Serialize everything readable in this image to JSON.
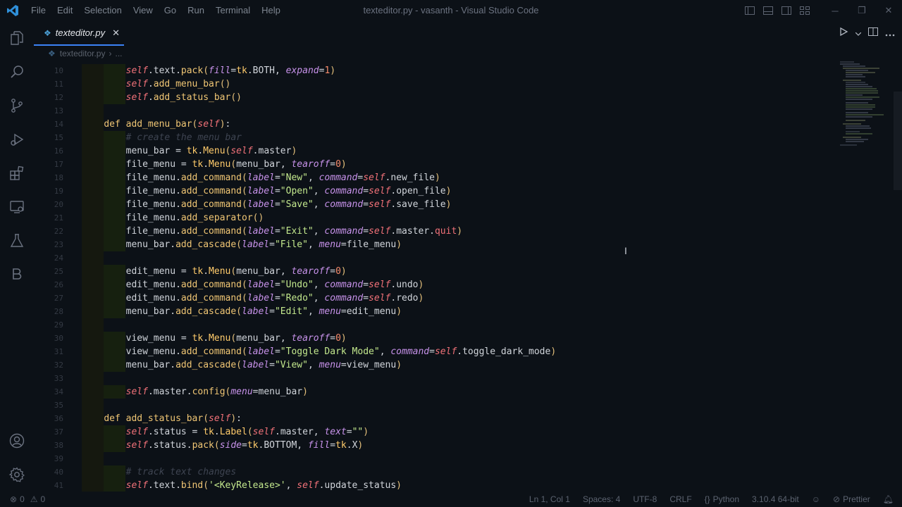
{
  "window": {
    "title": "texteditor.py - vasanth - Visual Studio Code"
  },
  "menu": [
    "File",
    "Edit",
    "Selection",
    "View",
    "Go",
    "Run",
    "Terminal",
    "Help"
  ],
  "tab": {
    "label": "texteditor.py",
    "close": "✕"
  },
  "breadcrumb": {
    "file": "texteditor.py",
    "sep": "›",
    "more": "..."
  },
  "statusbar": {
    "errors": "0",
    "warnings": "0",
    "position": "Ln 1, Col 1",
    "spaces": "Spaces: 4",
    "encoding": "UTF-8",
    "eol": "CRLF",
    "language": "Python",
    "interpreter": "3.10.4 64-bit",
    "formatter": "Prettier"
  },
  "code": {
    "lines": [
      {
        "n": "10"
      },
      {
        "n": "11"
      },
      {
        "n": "12"
      },
      {
        "n": "13"
      },
      {
        "n": "14"
      },
      {
        "n": "15"
      },
      {
        "n": "16"
      },
      {
        "n": "17"
      },
      {
        "n": "18"
      },
      {
        "n": "19"
      },
      {
        "n": "20"
      },
      {
        "n": "21"
      },
      {
        "n": "22"
      },
      {
        "n": "23"
      },
      {
        "n": "24"
      },
      {
        "n": "25"
      },
      {
        "n": "26"
      },
      {
        "n": "27"
      },
      {
        "n": "28"
      },
      {
        "n": "29"
      },
      {
        "n": "30"
      },
      {
        "n": "31"
      },
      {
        "n": "32"
      },
      {
        "n": "33"
      },
      {
        "n": "34"
      },
      {
        "n": "35"
      },
      {
        "n": "36"
      },
      {
        "n": "37"
      },
      {
        "n": "38"
      },
      {
        "n": "39"
      },
      {
        "n": "40"
      },
      {
        "n": "41"
      }
    ],
    "t": {
      "self": "self",
      "text": "text",
      "pack": "pack",
      "fill": "fill",
      "tk": "tk",
      "BOTH": "BOTH",
      "expand": "expand",
      "one": "1",
      "zero": "0",
      "add_menu_bar": "add_menu_bar",
      "add_status_bar": "add_status_bar",
      "def": "def",
      "c_create": "# create the menu bar",
      "menu_bar": "menu_bar",
      "Menu": "Menu",
      "master": "master",
      "file_menu": "file_menu",
      "tearoff": "tearoff",
      "add_command": "add_command",
      "label": "label",
      "s_new": "\"New\"",
      "command": "command",
      "new_file": "new_file",
      "s_open": "\"Open\"",
      "open_file": "open_file",
      "s_save": "\"Save\"",
      "save_file": "save_file",
      "add_separator": "add_separator",
      "s_exit": "\"Exit\"",
      "quit": "quit",
      "add_cascade": "add_cascade",
      "s_file": "\"File\"",
      "menu": "menu",
      "edit_menu": "edit_menu",
      "s_undo": "\"Undo\"",
      "undo": "undo",
      "s_redo": "\"Redo\"",
      "redo": "redo",
      "s_edit": "\"Edit\"",
      "view_menu": "view_menu",
      "s_toggle": "\"Toggle Dark Mode\"",
      "toggle_dark_mode": "toggle_dark_mode",
      "s_view": "\"View\"",
      "config": "config",
      "status": "status",
      "Label": "Label",
      "s_empty": "\"\"",
      "side": "side",
      "BOTTOM": "BOTTOM",
      "X": "X",
      "c_track": "# track text changes",
      "bind": "bind",
      "s_keyrel": "'<KeyRelease>'",
      "update_status": "update_status"
    }
  },
  "colors": {
    "accent": "#3b82f6",
    "background": "#0c1117",
    "keyword": "#f0c674",
    "string": "#c3e88d",
    "self": "#f07178",
    "param": "#c792ea",
    "number": "#f78c6c"
  }
}
